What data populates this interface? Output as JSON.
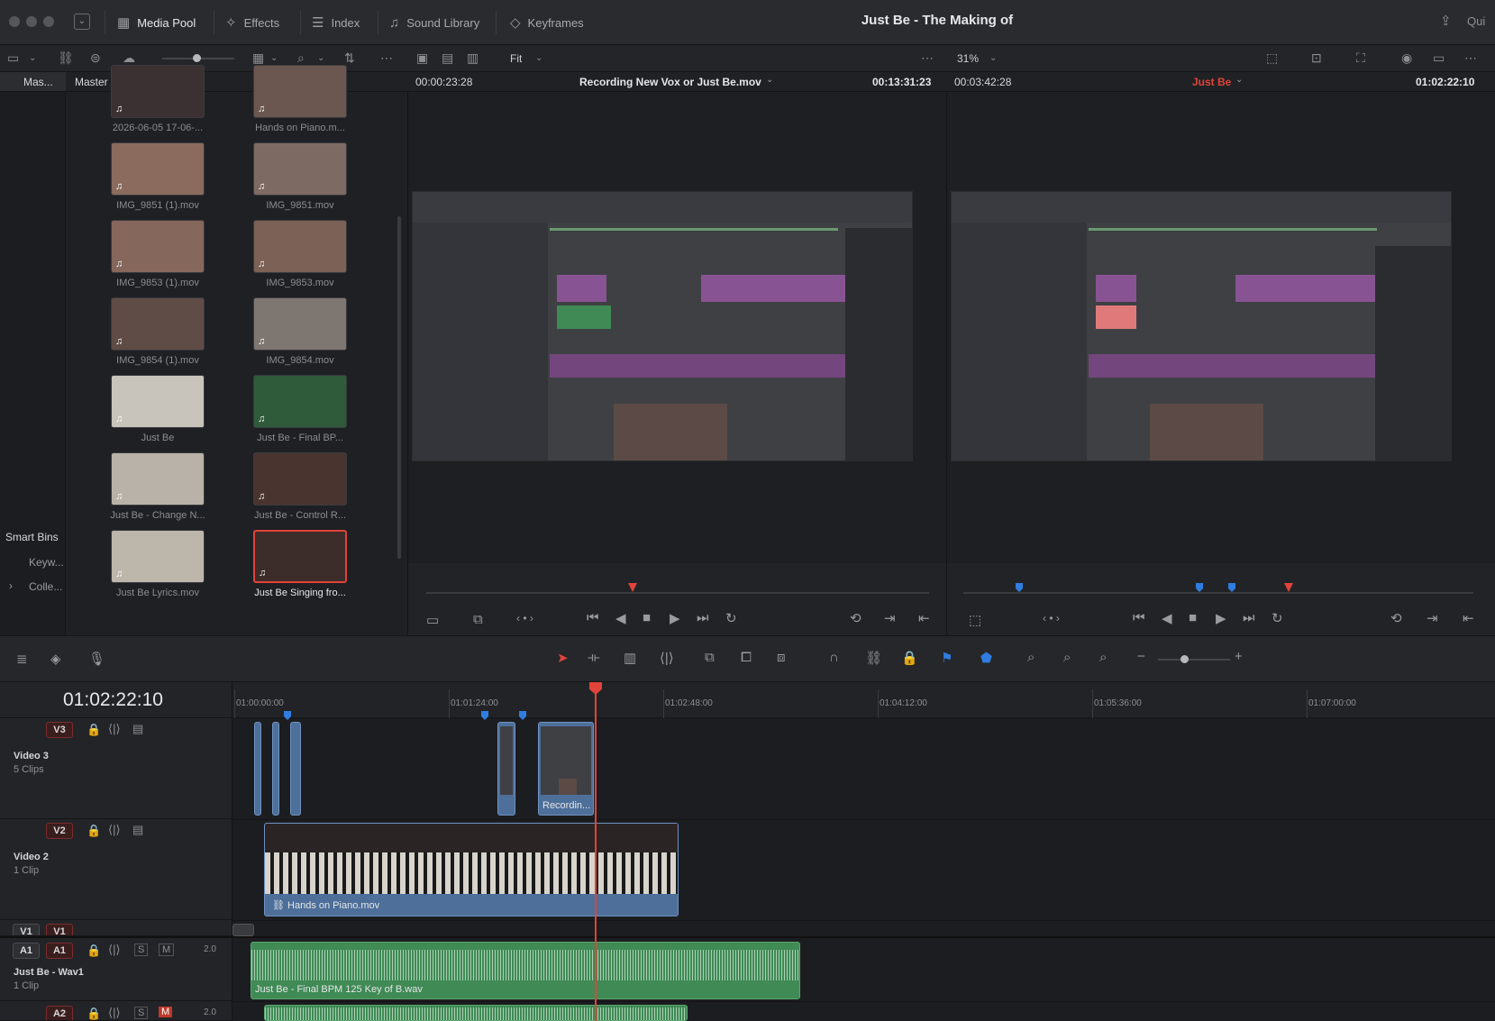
{
  "window": {
    "title": "Just Be - The Making of",
    "right_label": "Qui"
  },
  "tabs": [
    {
      "label": "Media Pool",
      "icon": "media-pool-icon",
      "glyph": "▦"
    },
    {
      "label": "Effects",
      "icon": "effects-icon",
      "glyph": "✧"
    },
    {
      "label": "Index",
      "icon": "index-icon",
      "glyph": "☰"
    },
    {
      "label": "Sound Library",
      "icon": "sound-library-icon",
      "glyph": "♫"
    },
    {
      "label": "Keyframes",
      "icon": "keyframes-icon",
      "glyph": "◇"
    }
  ],
  "toolbar": {
    "fit_label": "Fit",
    "zoom_label": "31%"
  },
  "sidebar": {
    "master_short": "Mas...",
    "smart_bins": "Smart Bins",
    "items": [
      "Keyw...",
      "Colle..."
    ]
  },
  "pool": {
    "bin_title": "Master",
    "clips": [
      {
        "name": "2026-06-05 17-06-...",
        "tone": "#3b3132"
      },
      {
        "name": "Hands on Piano.m...",
        "tone": "#6b5650"
      },
      {
        "name": "IMG_9851 (1).mov",
        "tone": "#8a6b5d"
      },
      {
        "name": "IMG_9851.mov",
        "tone": "#7d6a63"
      },
      {
        "name": "IMG_9853 (1).mov",
        "tone": "#86675b"
      },
      {
        "name": "IMG_9853.mov",
        "tone": "#7b6156"
      },
      {
        "name": "IMG_9854 (1).mov",
        "tone": "#5f4c46"
      },
      {
        "name": "IMG_9854.mov",
        "tone": "#7e7671"
      },
      {
        "name": "Just Be",
        "tone": "#c9c4bb"
      },
      {
        "name": "Just Be -  Final BP...",
        "tone": "#2f5b3b"
      },
      {
        "name": "Just Be - Change N...",
        "tone": "#b8b2a8"
      },
      {
        "name": "Just Be - Control R...",
        "tone": "#4a3430"
      },
      {
        "name": "Just Be Lyrics.mov",
        "tone": "#bcb6ab"
      },
      {
        "name": "Just Be Singing fro...",
        "tone": "#3c2c2a"
      }
    ]
  },
  "source_viewer": {
    "timecode_left": "00:00:23:28",
    "clip_name": "Recording New Vox or Just Be.mov",
    "timecode_right": "00:13:31:23"
  },
  "timeline_viewer": {
    "timecode_left": "00:03:42:28",
    "clip_name": "Just Be",
    "timecode_right": "01:02:22:10"
  },
  "timeline": {
    "current_timecode": "01:02:22:10",
    "ruler": [
      "01:00:00:00",
      "01:01:24:00",
      "01:02:48:00",
      "01:04:12:00",
      "01:05:36:00",
      "01:07:00:00"
    ],
    "tracks": [
      {
        "id": "V3",
        "name": "Video 3",
        "count": "5 Clips"
      },
      {
        "id": "V2",
        "name": "Video 2",
        "count": "1 Clip"
      },
      {
        "id": "V1",
        "name": "",
        "count": ""
      },
      {
        "id": "A1",
        "name": "Just Be - Wav1",
        "count": "1 Clip",
        "channels": "2.0"
      },
      {
        "id": "A2",
        "name": "",
        "count": "",
        "channels": "2.0"
      }
    ],
    "clips": {
      "v3_recording": "Recordin...",
      "v2_piano": "Hands on Piano.mov",
      "a1_wav": "Just Be -  Final BPM 125 Key of B.wav"
    }
  },
  "colors": {
    "accent_red": "#e0443a",
    "marker_blue": "#2f7de0",
    "video_clip": "#4d6f9a",
    "audio_clip": "#3f8a55"
  }
}
